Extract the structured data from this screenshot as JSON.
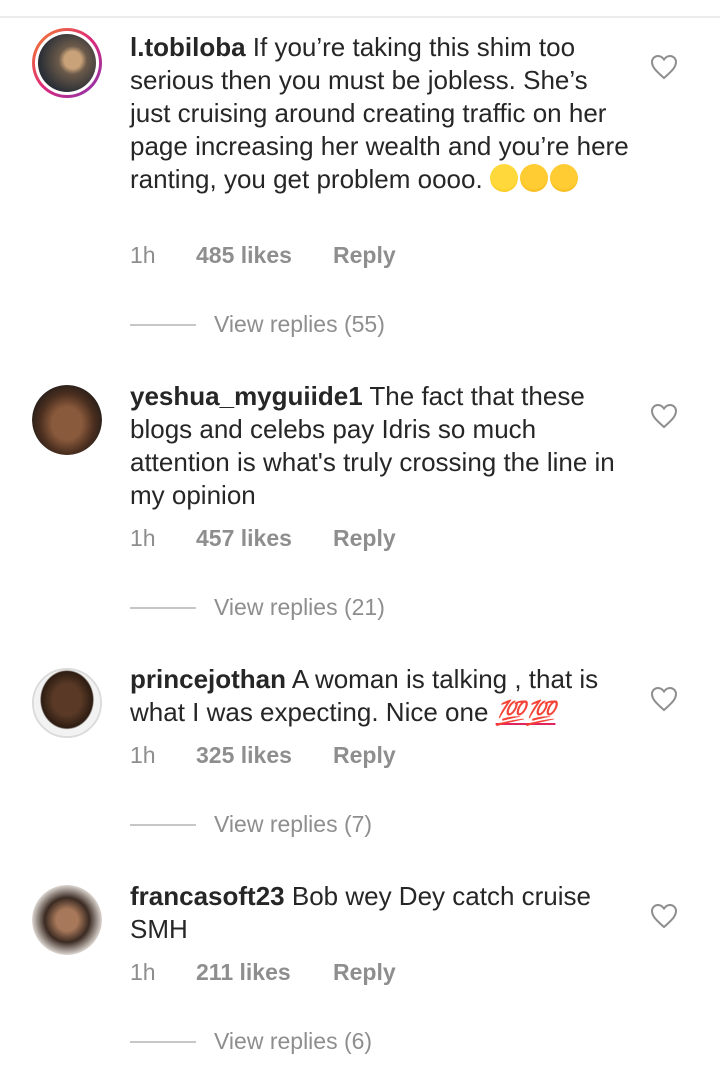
{
  "comments": [
    {
      "username": "l.tobiloba",
      "text": "If you’re taking this shim too serious then you must be jobless. She’s just cruising around creating traffic on her page increasing her wealth and you’re here ranting, you get problem oooo.",
      "emojis": [
        "grinning-sweat-emoji",
        "cat-tears-joy-emoji",
        "cat-tears-joy-emoji"
      ],
      "time": "1h",
      "likes": "485 likes",
      "reply": "Reply",
      "view_replies": "View replies (55)"
    },
    {
      "username": "yeshua_myguiide1",
      "text": "The fact that these blogs and celebs pay Idris so much attention is what's truly crossing the line in my opinion",
      "time": "1h",
      "likes": "457 likes",
      "reply": "Reply",
      "view_replies": "View replies (21)"
    },
    {
      "username": "princejothan",
      "text": "A woman is talking , that is what I was expecting.  Nice one",
      "suffix": "💯💯",
      "time": "1h",
      "likes": "325 likes",
      "reply": "Reply",
      "view_replies": "View replies (7)"
    },
    {
      "username": "francasoft23",
      "text": "Bob wey Dey catch cruise SMH",
      "time": "1h",
      "likes": "211 likes",
      "reply": "Reply",
      "view_replies": "View replies (6)"
    }
  ],
  "colors": {
    "text": "#262626",
    "muted": "#8e8e8e",
    "story_ring": "#dd2a7b"
  }
}
